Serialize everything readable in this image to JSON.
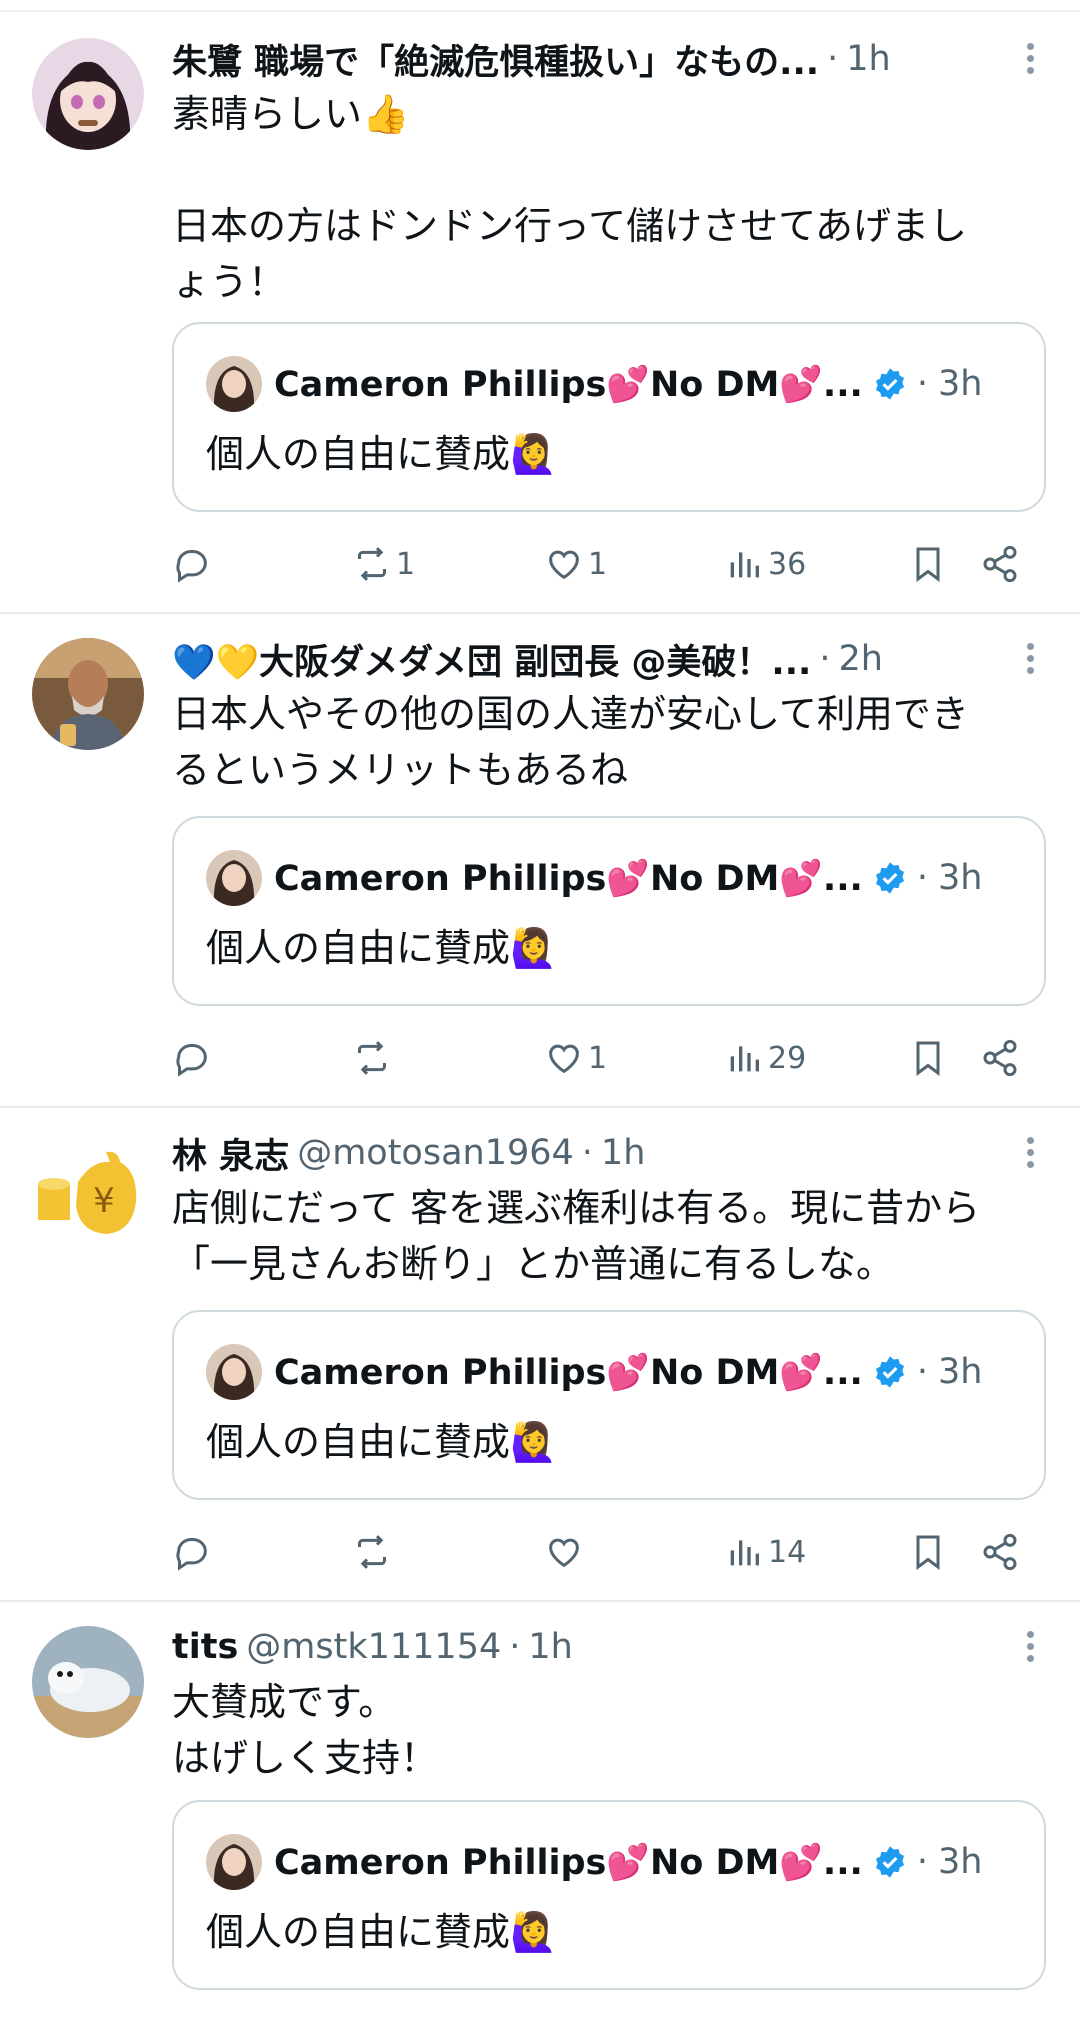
{
  "colors": {
    "text": "#0f1419",
    "muted": "#536471",
    "verified": "#1d9bf0",
    "border": "#cfd9de"
  },
  "quoted": {
    "name": "Cameron Phillips💕No DM💕...",
    "time": "3h",
    "text": "個人の自由に賛成🙋‍♀️",
    "verified": true
  },
  "tweets": [
    {
      "name": "朱鷺 職場で「絶滅危惧種扱い」なもの...",
      "handle": "",
      "time": "1h",
      "lines": [
        "素晴らしい👍",
        "",
        "日本の方はドンドン行って儲けさせてあげまし",
        "ょう！"
      ],
      "reply_count": "",
      "retweet_count": "1",
      "like_count": "1",
      "view_count": "36"
    },
    {
      "name": "💙💛大阪ダメダメ団 副団長 @美破！...",
      "handle": "",
      "time": "2h",
      "lines": [
        "日本人やその他の国の人達が安心して利用でき",
        "るというメリットもあるね"
      ],
      "reply_count": "",
      "retweet_count": "",
      "like_count": "1",
      "view_count": "29"
    },
    {
      "name": "林 泉志",
      "handle": "@motosan1964",
      "time": "1h",
      "lines": [
        "店側にだって 客を選ぶ権利は有る。現に昔から",
        "「一見さんお断り」とか普通に有るしな。"
      ],
      "reply_count": "",
      "retweet_count": "",
      "like_count": "",
      "view_count": "14"
    },
    {
      "name": "tits",
      "handle": "@mstk111154",
      "time": "1h",
      "lines": [
        "大賛成です。",
        "はげしく支持！"
      ]
    }
  ]
}
